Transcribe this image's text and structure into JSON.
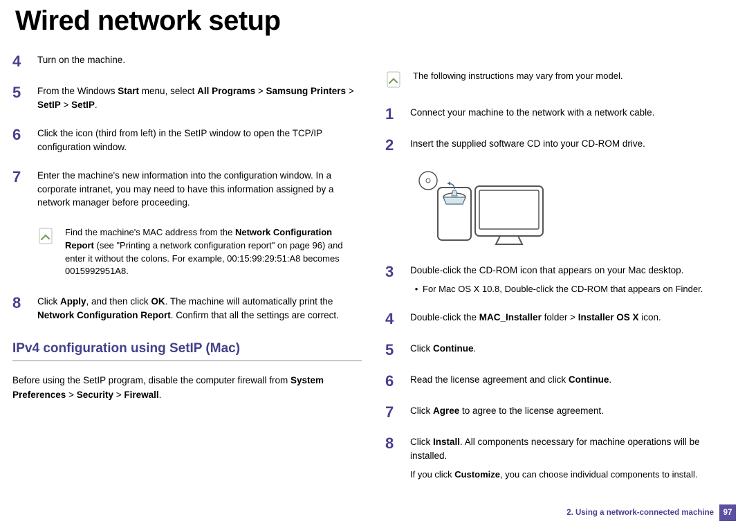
{
  "title": "Wired network setup",
  "leftSteps": {
    "s4": {
      "num": "4",
      "text": "Turn on the machine."
    },
    "s5": {
      "num": "5",
      "pre": "From the Windows ",
      "b1": "Start",
      "mid1": " menu, select ",
      "b2": "All Programs",
      "gt1": " > ",
      "b3": "Samsung Printers",
      "gt2": " > ",
      "b4": "SetIP",
      "gt3": " > ",
      "b5": "SetIP",
      "end": "."
    },
    "s6": {
      "num": "6",
      "text": "Click the        icon (third from left) in the SetIP window to open the TCP/IP configuration window."
    },
    "s7": {
      "num": "7",
      "text": "Enter the machine's new information into the configuration window. In a corporate intranet, you may need to have this information assigned by a network manager before proceeding."
    },
    "note1": {
      "pre": "Find the machine's MAC address from the ",
      "b1": "Network Configuration Report",
      "post": " (see \"Printing a network configuration report\" on page 96) and enter it without the colons. For example, 00:15:99:29:51:A8 becomes 0015992951A8."
    },
    "s8": {
      "num": "8",
      "pre": "Click ",
      "b1": "Apply",
      "mid1": ", and then click ",
      "b2": "OK",
      "mid2": ". The machine will automatically print the ",
      "b3": "Network Configuration Report",
      "end": ". Confirm that all the settings are correct."
    }
  },
  "section": {
    "heading": "IPv4 configuration using SetIP (Mac)",
    "para_pre": "Before using the SetIP program, disable the computer firewall from ",
    "b1": "System Preferences",
    "gt1": " > ",
    "b2": "Security",
    "gt2": " > ",
    "b3": "Firewall",
    "end": "."
  },
  "rightNote": "The following instructions may vary from your model.",
  "rightSteps": {
    "s1": {
      "num": "1",
      "text": "Connect your machine to the network with a network cable."
    },
    "s2": {
      "num": "2",
      "text": "Insert the supplied software CD into your CD-ROM drive."
    },
    "s3": {
      "num": "3",
      "text": "Double-click the CD-ROM icon that appears on your Mac desktop.",
      "bullet": "For Mac OS X 10.8, Double-click the CD-ROM that appears on Finder."
    },
    "s4": {
      "num": "4",
      "pre": "Double-click the ",
      "b1": "MAC_Installer",
      "mid1": " folder > ",
      "b2": "Installer OS X",
      "end": " icon."
    },
    "s5": {
      "num": "5",
      "pre": "Click ",
      "b1": "Continue",
      "end": "."
    },
    "s6": {
      "num": "6",
      "pre": "Read the license agreement and click ",
      "b1": "Continue",
      "end": "."
    },
    "s7": {
      "num": "7",
      "pre": "Click ",
      "b1": "Agree",
      "end": " to agree to the license agreement."
    },
    "s8": {
      "num": "8",
      "pre": "Click ",
      "b1": "Install",
      "mid": ". All components necessary for machine operations will be installed.",
      "sub_pre": "If you click ",
      "sub_b": "Customize",
      "sub_end": ", you can choose individual components to install."
    }
  },
  "footer": {
    "chapter": "2.  Using a network-connected machine",
    "page": "97"
  }
}
